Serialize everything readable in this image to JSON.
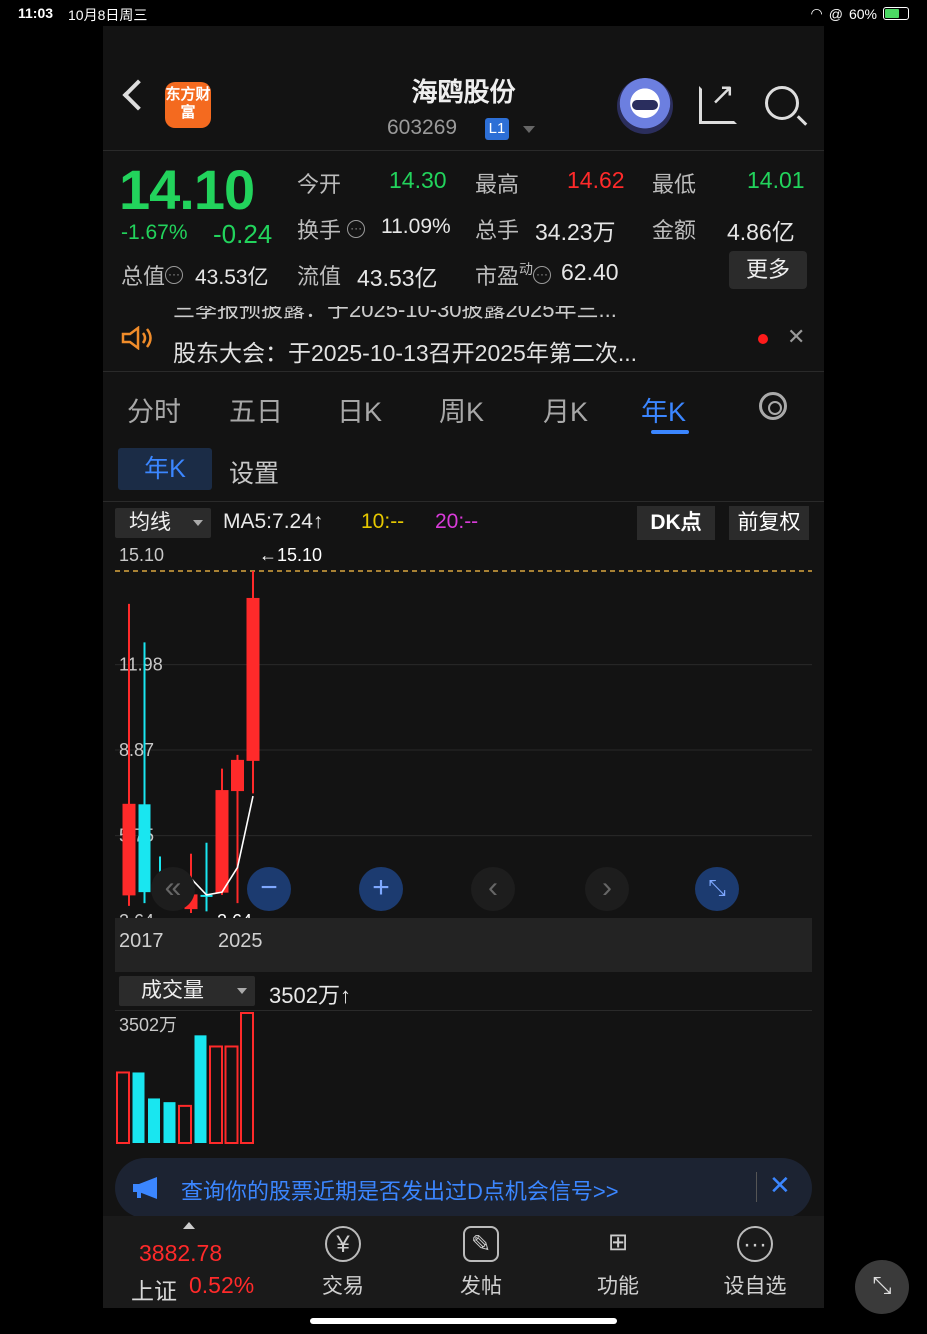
{
  "status": {
    "time": "11:03",
    "date": "10月8日周三",
    "battery": "60%"
  },
  "header": {
    "logo": "东方财富",
    "title": "海鸥股份",
    "code": "603269",
    "badge": "L1"
  },
  "quote": {
    "price": "14.10",
    "change_pct": "-1.67%",
    "change_val": "-0.24",
    "open_label": "今开",
    "open": "14.30",
    "high_label": "最高",
    "high": "14.62",
    "low_label": "最低",
    "low": "14.01",
    "turnover_label": "换手",
    "turnover": "11.09%",
    "volume_label": "总手",
    "volume": "34.23万",
    "amount_label": "金额",
    "amount": "4.86亿",
    "mktcap_label": "总值",
    "mktcap": "43.53亿",
    "float_label": "流值",
    "float_cap": "43.53亿",
    "pe_label": "市盈",
    "pe_sup": "动",
    "pe": "62.40",
    "more": "更多"
  },
  "notice": {
    "ghost": "三季报预披露：于2025-10-30披露2025年三...",
    "text": "股东大会：于2025-10-13召开2025年第二次..."
  },
  "tabs": [
    "分时",
    "五日",
    "日K",
    "周K",
    "月K",
    "年K"
  ],
  "subtabs": {
    "active": "年K",
    "settings": "设置"
  },
  "indicators": {
    "ma_dropdown": "均线",
    "ma5": "MA5:7.24↑",
    "ma10": "10:--",
    "ma20": "20:--",
    "dk": "DK点",
    "fq": "前复权"
  },
  "kline": {
    "yticks": [
      "15.10",
      "11.98",
      "8.87",
      "5.75",
      "2.64"
    ],
    "max_label": "←15.10",
    "min_label": "←2.64",
    "x_start": "2017",
    "x_end": "2025"
  },
  "chart_data": {
    "type": "candlestick",
    "x": [
      "2017",
      "2018",
      "2019",
      "2020",
      "2021",
      "2022",
      "2023",
      "2024",
      "2025"
    ],
    "candles": [
      {
        "open": 3.3,
        "close": 6.6,
        "high": 13.9,
        "low": 2.9,
        "color": "red"
      },
      {
        "open": 6.6,
        "close": 3.4,
        "high": 12.5,
        "low": 3.0,
        "color": "cyan"
      },
      {
        "open": 3.4,
        "close": 3.2,
        "high": 4.7,
        "low": 2.9,
        "color": "cyan"
      },
      {
        "open": 3.2,
        "close": 2.9,
        "high": 4.0,
        "low": 2.8,
        "color": "cyan"
      },
      {
        "open": 2.8,
        "close": 3.3,
        "high": 4.8,
        "low": 2.64,
        "color": "red"
      },
      {
        "open": 3.3,
        "close": 3.3,
        "high": 5.2,
        "low": 2.7,
        "color": "cyan"
      },
      {
        "open": 3.4,
        "close": 7.1,
        "high": 7.9,
        "low": 3.3,
        "color": "red"
      },
      {
        "open": 7.1,
        "close": 8.2,
        "high": 8.4,
        "low": 3.0,
        "color": "red"
      },
      {
        "open": 8.2,
        "close": 14.1,
        "high": 15.1,
        "low": 7.0,
        "color": "red"
      }
    ],
    "ma5": [
      null,
      null,
      null,
      null,
      3.9,
      3.3,
      3.4,
      4.3,
      6.9
    ],
    "ylim": [
      2.64,
      15.1
    ],
    "volume": {
      "label": "成交量",
      "max_label": "3502万",
      "current": "3502万↑",
      "values": [
        1900,
        1900,
        1200,
        1100,
        1000,
        2900,
        2600,
        2600,
        3502
      ],
      "colors": [
        "red",
        "cyan",
        "cyan",
        "cyan",
        "red",
        "cyan",
        "red",
        "red",
        "red"
      ]
    }
  },
  "banner": {
    "text": "查询你的股票近期是否发出过D点机会信号>>"
  },
  "bottom": {
    "index_value": "3882.78",
    "index_name": "上证",
    "index_pct": "0.52%",
    "nav": [
      "交易",
      "发帖",
      "功能",
      "设自选"
    ]
  }
}
